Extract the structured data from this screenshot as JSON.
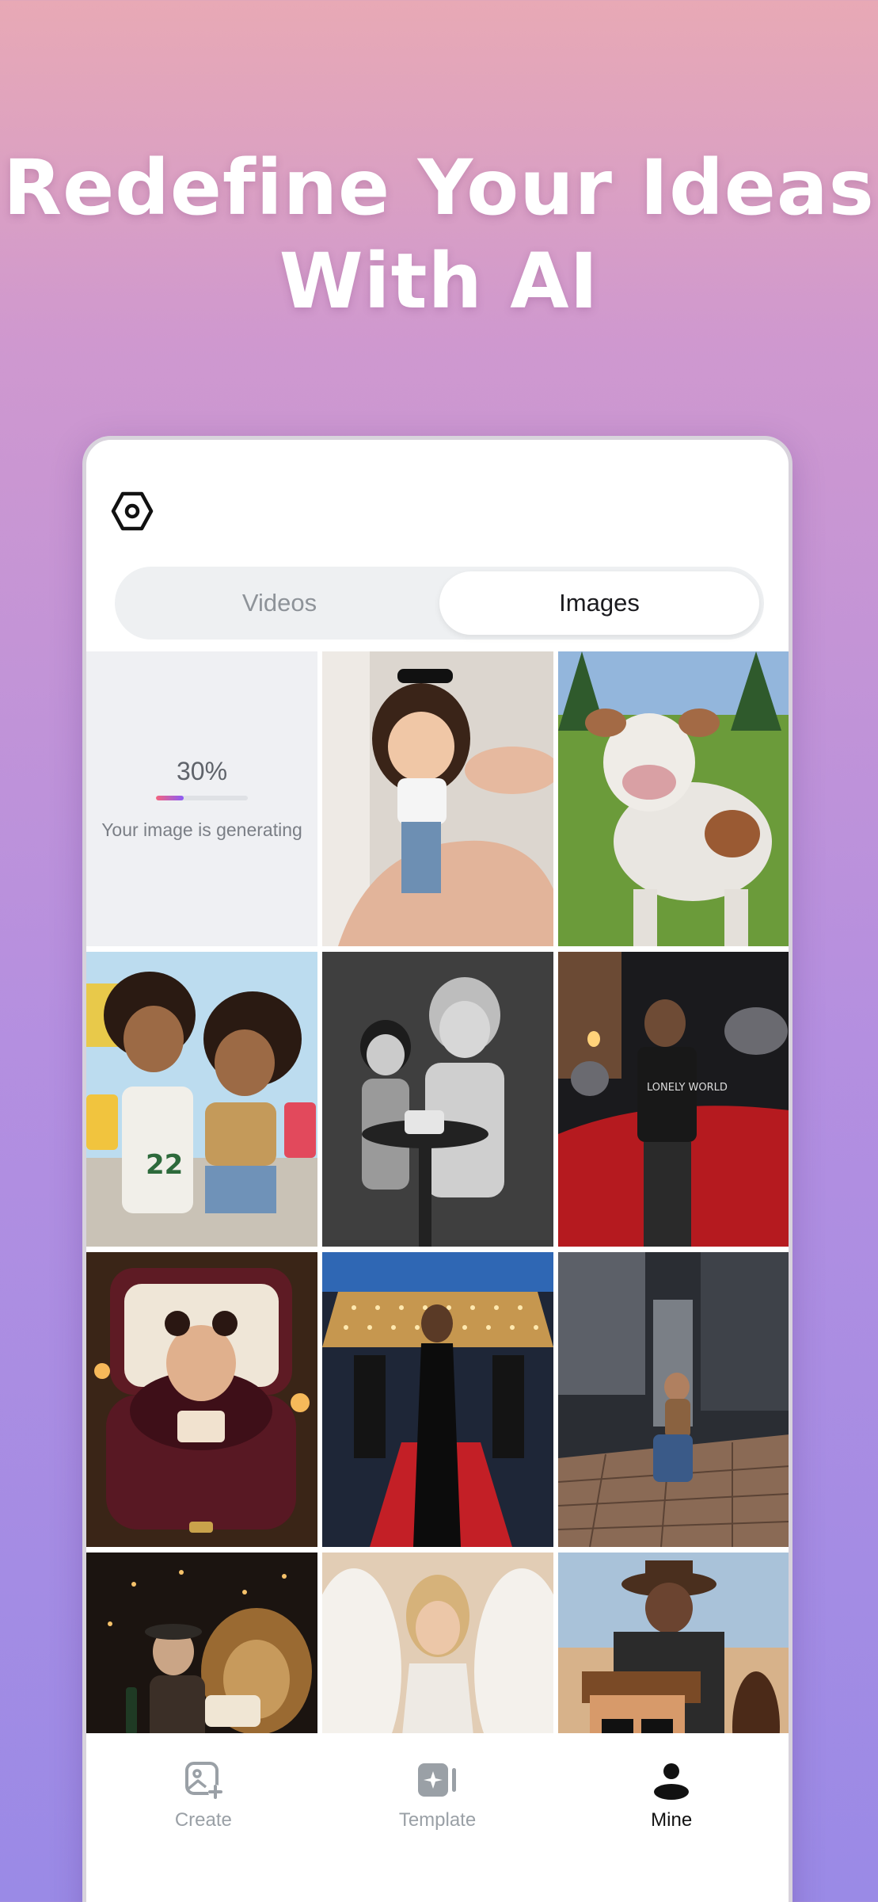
{
  "hero": {
    "line1": "Redefine Your Ideas",
    "line2": "With AI"
  },
  "header": {
    "settings_icon": "settings-hexagon-icon"
  },
  "tabs": [
    {
      "label": "Videos",
      "active": false
    },
    {
      "label": "Images",
      "active": true
    }
  ],
  "generating": {
    "percent_label": "30%",
    "progress": 0.3,
    "status_text": "Your image is generating"
  },
  "gallery": [
    {
      "name": "chibi-doll-figure"
    },
    {
      "name": "cartoon-cow"
    },
    {
      "name": "beach-cartoon-girls"
    },
    {
      "name": "grandmother-birthday"
    },
    {
      "name": "red-carpet-car"
    },
    {
      "name": "ring-box-figure"
    },
    {
      "name": "gala-red-carpet"
    },
    {
      "name": "skyscraper-fall"
    },
    {
      "name": "lion-celebration"
    },
    {
      "name": "angel-wings-woman"
    },
    {
      "name": "pixel-cowboy"
    }
  ],
  "nav": {
    "create_label": "Create",
    "template_label": "Template",
    "mine_label": "Mine",
    "active": "Mine"
  },
  "colors": {
    "accent_start": "#f4637d",
    "accent_end": "#8b5cf6",
    "nav_active": "#111111",
    "nav_inactive": "#9aa0a6"
  }
}
